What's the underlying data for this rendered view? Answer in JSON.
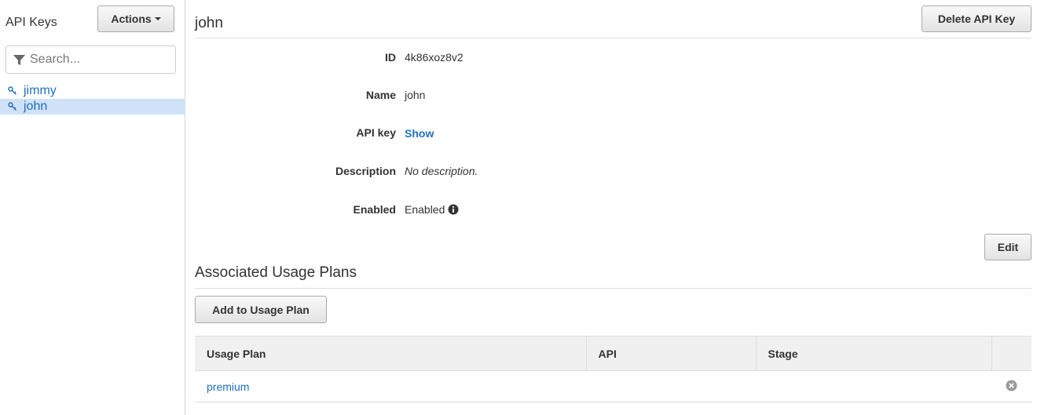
{
  "sidebar": {
    "title": "API Keys",
    "actions_label": "Actions",
    "search_placeholder": "Search...",
    "keys": [
      {
        "label": "jimmy",
        "selected": false
      },
      {
        "label": "john",
        "selected": true
      }
    ]
  },
  "main": {
    "title": "john",
    "delete_label": "Delete API Key",
    "fields": {
      "id_label": "ID",
      "id_value": "4k86xoz8v2",
      "name_label": "Name",
      "name_value": "john",
      "apikey_label": "API key",
      "apikey_value": "Show",
      "description_label": "Description",
      "description_value": "No description.",
      "enabled_label": "Enabled",
      "enabled_value": "Enabled"
    },
    "edit_label": "Edit",
    "usage_section": {
      "title": "Associated Usage Plans",
      "add_label": "Add to Usage Plan",
      "columns": [
        "Usage Plan",
        "API",
        "Stage",
        ""
      ],
      "rows": [
        {
          "usage_plan": "premium",
          "api": "",
          "stage": ""
        }
      ]
    }
  },
  "colors": {
    "link": "#1f6fbf",
    "selected_row": "#cfe2f7",
    "table_header": "#f0f0f0"
  },
  "icons": [
    "filter-icon",
    "key-icon",
    "info-icon",
    "remove-icon",
    "caret-down-icon"
  ]
}
